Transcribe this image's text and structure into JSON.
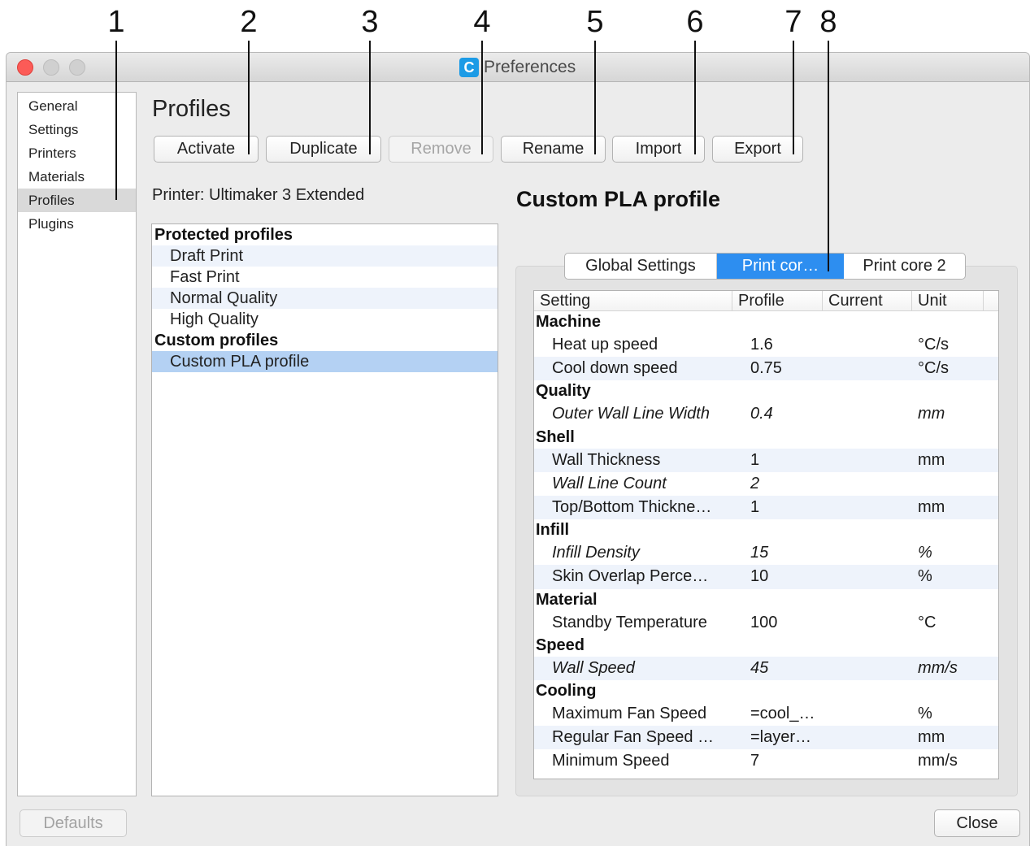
{
  "callouts": [
    "1",
    "2",
    "3",
    "4",
    "5",
    "6",
    "7",
    "8"
  ],
  "window": {
    "title": "Preferences",
    "app_icon_glyph": "C",
    "accent_color": "#2d8ef0"
  },
  "sidebar": {
    "items": [
      {
        "label": "General"
      },
      {
        "label": "Settings"
      },
      {
        "label": "Printers"
      },
      {
        "label": "Materials"
      },
      {
        "label": "Profiles",
        "selected": true
      },
      {
        "label": "Plugins"
      }
    ]
  },
  "main": {
    "heading": "Profiles",
    "toolbar": {
      "activate": "Activate",
      "duplicate": "Duplicate",
      "remove": "Remove",
      "rename": "Rename",
      "import": "Import",
      "export": "Export"
    },
    "printer_label": "Printer: Ultimaker 3 Extended",
    "profiles": {
      "protected_header": "Protected profiles",
      "protected": [
        "Draft Print",
        "Fast Print",
        "Normal Quality",
        "High Quality"
      ],
      "custom_header": "Custom profiles",
      "custom": [
        "Custom PLA profile"
      ]
    }
  },
  "detail": {
    "title": "Custom PLA profile",
    "tabs": [
      "Global Settings",
      "Print cor…",
      "Print core 2"
    ],
    "columns": [
      "Setting",
      "Profile",
      "Current",
      "Unit"
    ],
    "groups": [
      {
        "category": "Machine",
        "rows": [
          {
            "name": "Heat up speed",
            "profile": "1.6",
            "current": "",
            "unit": "°C/s"
          },
          {
            "name": "Cool down speed",
            "profile": "0.75",
            "current": "",
            "unit": "°C/s"
          }
        ]
      },
      {
        "category": "Quality",
        "rows": [
          {
            "name": "Outer Wall Line Width",
            "profile": "0.4",
            "current": "",
            "unit": "mm"
          }
        ]
      },
      {
        "category": "Shell",
        "rows": [
          {
            "name": "Wall Thickness",
            "profile": "1",
            "current": "",
            "unit": "mm"
          },
          {
            "name": "Wall Line Count",
            "profile": "2",
            "current": "",
            "unit": ""
          },
          {
            "name": "Top/Bottom Thickne…",
            "profile": "1",
            "current": "",
            "unit": "mm"
          }
        ]
      },
      {
        "category": "Infill",
        "rows": [
          {
            "name": "Infill Density",
            "profile": "15",
            "current": "",
            "unit": "%"
          },
          {
            "name": "Skin Overlap Perce…",
            "profile": "10",
            "current": "",
            "unit": "%"
          }
        ]
      },
      {
        "category": "Material",
        "rows": [
          {
            "name": "Standby Temperature",
            "profile": "100",
            "current": "",
            "unit": "°C"
          }
        ]
      },
      {
        "category": "Speed",
        "rows": [
          {
            "name": "Wall Speed",
            "profile": "45",
            "current": "",
            "unit": "mm/s"
          }
        ]
      },
      {
        "category": "Cooling",
        "rows": [
          {
            "name": "Maximum Fan Speed",
            "profile": "=cool_…",
            "current": "",
            "unit": "%"
          },
          {
            "name": "Regular Fan Speed …",
            "profile": "=layer…",
            "current": "",
            "unit": "mm"
          },
          {
            "name": "Minimum Speed",
            "profile": "7",
            "current": "",
            "unit": "mm/s"
          }
        ]
      }
    ]
  },
  "footer": {
    "defaults": "Defaults",
    "close": "Close"
  }
}
